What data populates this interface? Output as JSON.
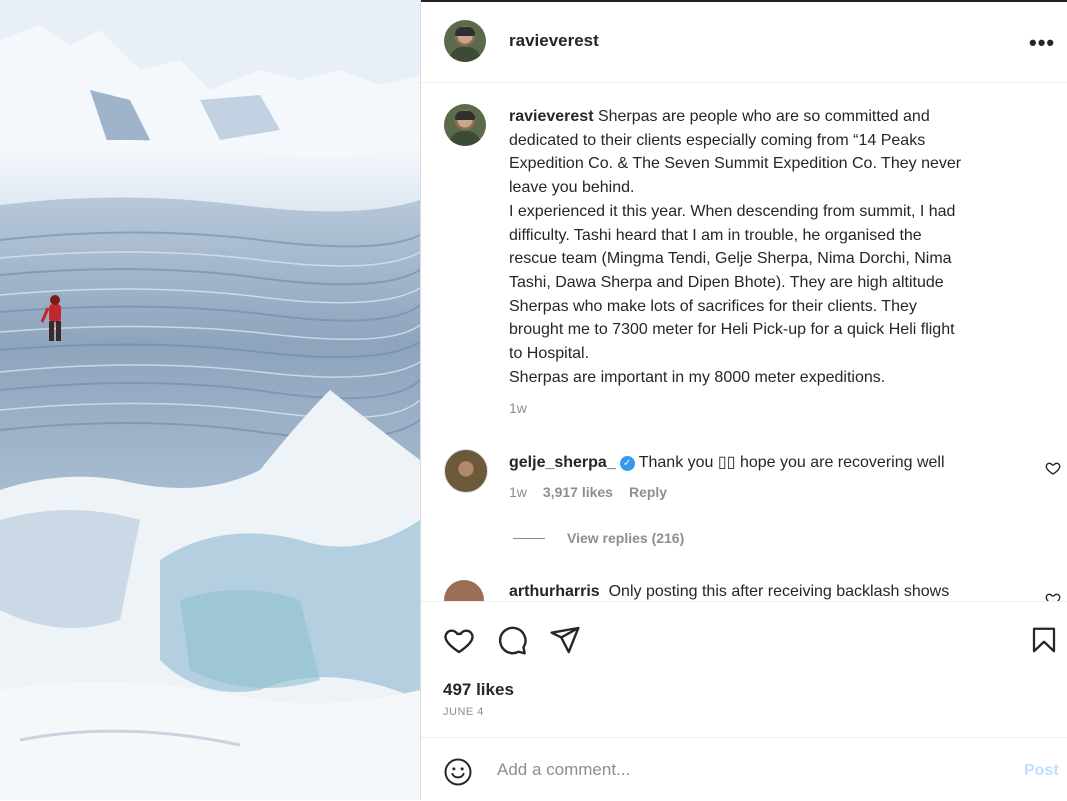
{
  "post": {
    "username": "ravieverest",
    "image_alt": "Climber on an icy crevasse wall"
  },
  "caption": {
    "username": "ravieverest",
    "lines": [
      " Sherpas are people who are so committed and",
      "dedicated to their clients especially coming from “14 Peaks",
      "Expedition Co. & The Seven Summit Expedition Co. They never",
      "leave you behind.",
      "I experienced it this year. When descending from summit, I had",
      "difficulty. Tashi heard that I am in trouble, he organised the",
      "rescue team (Mingma Tendi, Gelje Sherpa, Nima Dorchi, Nima",
      "Tashi, Dawa Sherpa and Dipen Bhote). They are high altitude",
      "Sherpas who make lots of sacrifices for their clients. They",
      "brought me to 7300 meter for Heli Pick-up for a quick Heli flight",
      "to Hospital.",
      "Sherpas are important in my 8000 meter expeditions."
    ],
    "time": "1w"
  },
  "comments": [
    {
      "username": "gelje_sherpa_",
      "verified": true,
      "text": "Thank you ▯▯ hope you are recovering well",
      "time": "1w",
      "likes": "3,917 likes",
      "reply_label": "Reply",
      "view_replies": "View replies (216)"
    },
    {
      "username": "arthurharris",
      "text": "Only posting this after receiving backlash shows"
    }
  ],
  "actions": {
    "like_icon": "heart-icon",
    "comment_icon": "comment-icon",
    "share_icon": "paper-plane-icon",
    "save_icon": "bookmark-icon"
  },
  "likes_count": "497 likes",
  "date": "JUNE 4",
  "add_comment": {
    "placeholder": "Add a comment...",
    "post_label": "Post",
    "emoji_icon": "smiley-icon"
  },
  "colors": {
    "verified": "#3897f0",
    "post_disabled": "#c0dffd",
    "muted_text": "#8e8e8e",
    "climber": "#c0282d"
  }
}
